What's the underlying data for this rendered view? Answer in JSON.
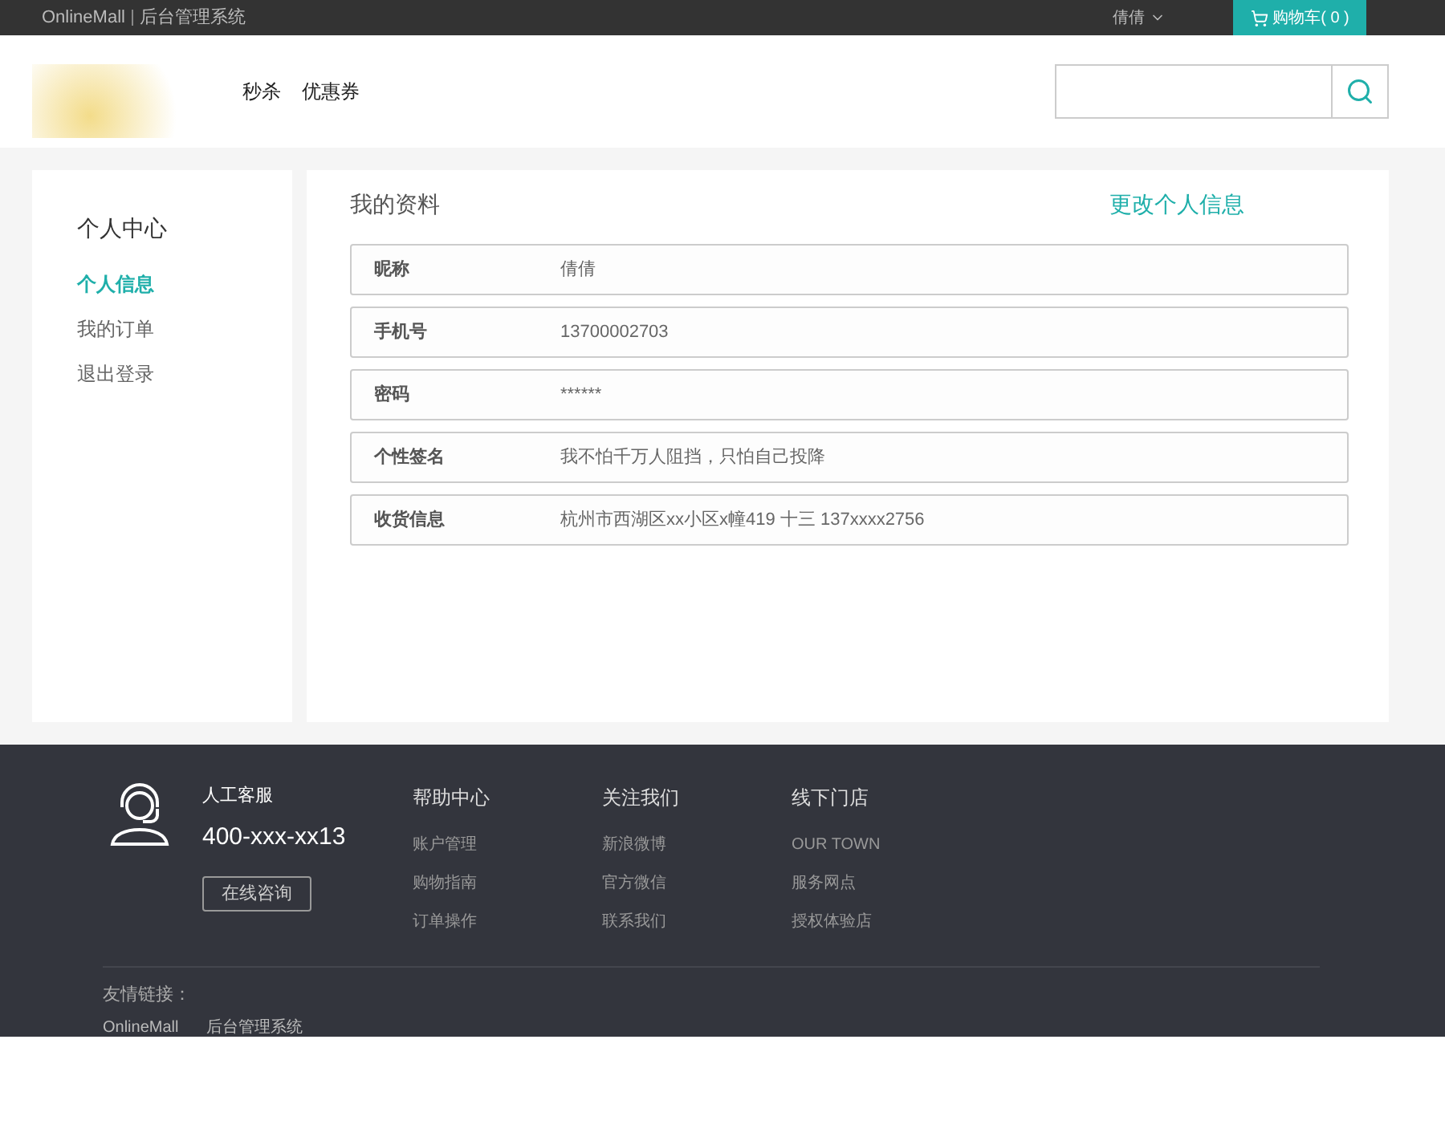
{
  "topbar": {
    "brand": "OnlineMall",
    "admin_link": "后台管理系统",
    "user": "倩倩",
    "cart": "购物车( 0 )"
  },
  "header": {
    "nav": [
      "秒杀",
      "优惠券"
    ]
  },
  "sidebar": {
    "title": "个人中心",
    "items": [
      {
        "label": "个人信息",
        "selected": true
      },
      {
        "label": "我的订单",
        "selected": false
      },
      {
        "label": "退出登录",
        "selected": false
      }
    ]
  },
  "profile": {
    "title": "我的资料",
    "edit_link": "更改个人信息",
    "fields": [
      {
        "label": "昵称",
        "value": "倩倩"
      },
      {
        "label": "手机号",
        "value": "13700002703"
      },
      {
        "label": "密码",
        "value": "******"
      },
      {
        "label": "个性签名",
        "value": "我不怕千万人阻挡，只怕自己投降"
      },
      {
        "label": "收货信息",
        "value": "杭州市西湖区xx小区x幢419 十三 137xxxx2756"
      }
    ]
  },
  "footer": {
    "service": {
      "title": "人工客服",
      "phone": "400-xxx-xx13",
      "button": "在线咨询"
    },
    "columns": [
      {
        "title": "帮助中心",
        "links": [
          "账户管理",
          "购物指南",
          "订单操作"
        ]
      },
      {
        "title": "关注我们",
        "links": [
          "新浪微博",
          "官方微信",
          "联系我们"
        ]
      },
      {
        "title": "线下门店",
        "links": [
          "OUR TOWN",
          "服务网点",
          "授权体验店"
        ]
      }
    ],
    "friend_links_label": "友情链接：",
    "friend_links": [
      "OnlineMall",
      "后台管理系统"
    ]
  }
}
